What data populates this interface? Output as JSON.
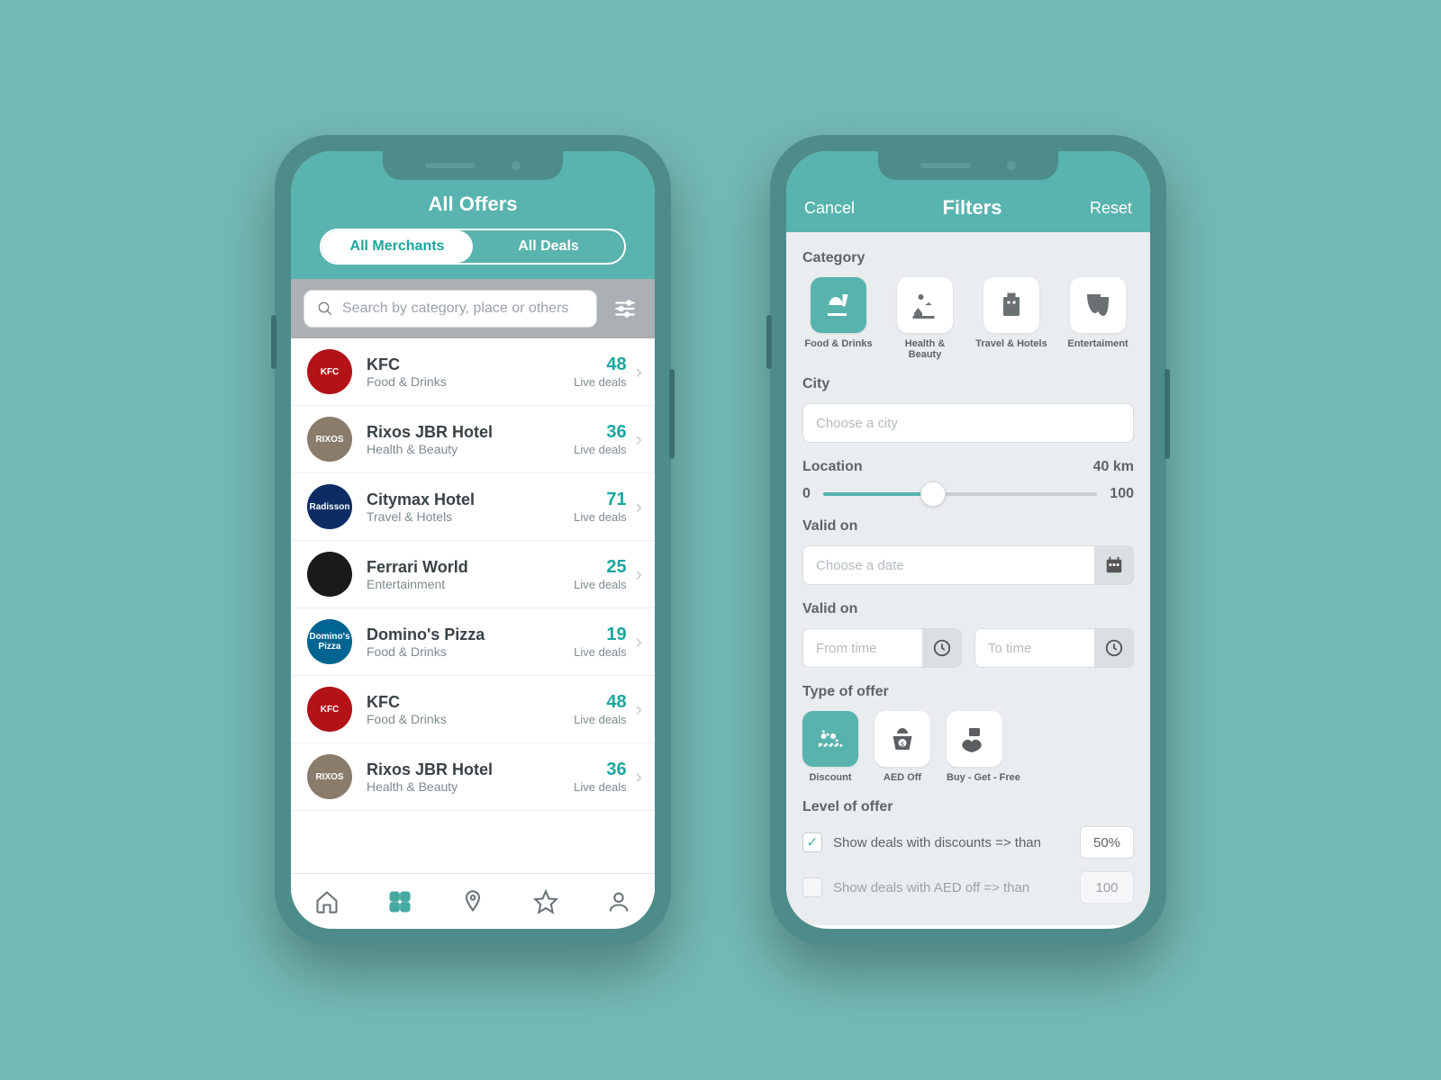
{
  "screen1": {
    "title": "All Offers",
    "tabs": [
      "All Merchants",
      "All Deals"
    ],
    "searchPlaceholder": "Search by category, place or others",
    "liveDealsLabel": "Live deals",
    "merchants": [
      {
        "name": "KFC",
        "category": "Food & Drinks",
        "deals": "48",
        "logo": "kfc",
        "logoText": "KFC"
      },
      {
        "name": "Rixos JBR Hotel",
        "category": "Health & Beauty",
        "deals": "36",
        "logo": "rixos",
        "logoText": "RIXOS"
      },
      {
        "name": "Citymax Hotel",
        "category": "Travel & Hotels",
        "deals": "71",
        "logo": "citymax",
        "logoText": "Radisson"
      },
      {
        "name": "Ferrari World",
        "category": "Entertainment",
        "deals": "25",
        "logo": "ferrari",
        "logoText": ""
      },
      {
        "name": "Domino's Pizza",
        "category": "Food & Drinks",
        "deals": "19",
        "logo": "dominos",
        "logoText": "Domino's Pizza"
      },
      {
        "name": "KFC",
        "category": "Food & Drinks",
        "deals": "48",
        "logo": "kfc",
        "logoText": "KFC"
      },
      {
        "name": "Rixos JBR Hotel",
        "category": "Health & Beauty",
        "deals": "36",
        "logo": "rixos",
        "logoText": "RIXOS"
      }
    ]
  },
  "screen2": {
    "cancel": "Cancel",
    "title": "Filters",
    "reset": "Reset",
    "categoryLabel": "Category",
    "categories": [
      "Food & Drinks",
      "Health & Beauty",
      "Travel & Hotels",
      "Entertaiment"
    ],
    "cityLabel": "City",
    "cityPlaceholder": "Choose a city",
    "locationLabel": "Location",
    "locationValue": "40 km",
    "sliderMin": "0",
    "sliderMax": "100",
    "validOnLabel": "Valid on",
    "datePlaceholder": "Choose a date",
    "fromTimePlaceholder": "From time",
    "toTimePlaceholder": "To time",
    "typeLabel": "Type of offer",
    "types": [
      "Discount",
      "AED Off",
      "Buy - Get - Free"
    ],
    "levelLabel": "Level of offer",
    "check1Text": "Show deals with discounts => than",
    "check1Val": "50%",
    "check2Text": "Show deals with AED off => than",
    "check2Val": "100"
  }
}
